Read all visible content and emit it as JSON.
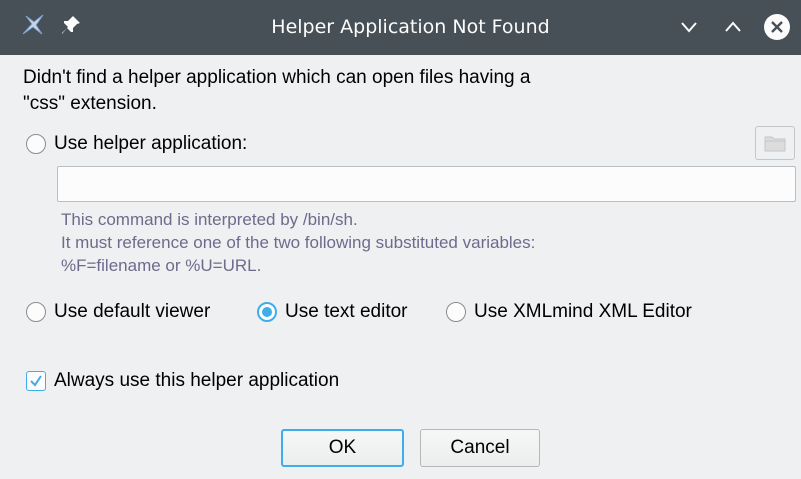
{
  "window": {
    "title": "Helper Application Not Found",
    "icons": {
      "app": "app-icon",
      "pin": "pin-icon",
      "minimize": "chevron-down-icon",
      "maximize": "chevron-up-icon",
      "close": "close-icon"
    }
  },
  "dialog": {
    "message_line1": "Didn't find a helper application which can open files having a",
    "message_line2": "\"css\" extension.",
    "use_helper_label": "Use helper application:",
    "command_value": "",
    "hint_line1": "This command is interpreted by /bin/sh.",
    "hint_line2": "It must reference one of the two following substituted variables:",
    "hint_line3": "%F=filename or %U=URL.",
    "option_default_viewer": "Use default viewer",
    "option_text_editor": "Use text editor",
    "option_xmlmind": "Use XMLmind XML Editor",
    "selected_option": "Use text editor",
    "always_use_label": "Always use this helper application",
    "always_use_checked": true,
    "ok_label": "OK",
    "cancel_label": "Cancel"
  },
  "colors": {
    "titlebar": "#475057",
    "accent": "#3daee9",
    "hint_text": "#6f6a8c",
    "background": "#eff0f1"
  }
}
